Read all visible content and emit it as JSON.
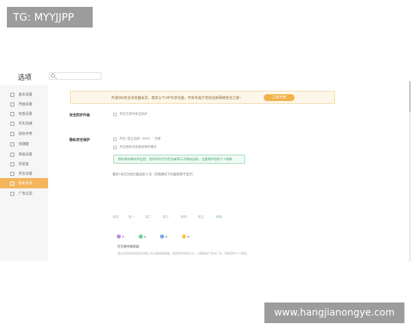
{
  "watermarks": {
    "top": "TG: MYYJJPP",
    "bottom": "www.hangjianongye.com"
  },
  "window": {
    "title": "选项",
    "search": {
      "placeholder": ""
    }
  },
  "sidebar": {
    "items": [
      {
        "label": "基本设置",
        "icon": "gear-icon"
      },
      {
        "label": "界面设置",
        "icon": "layout-icon"
      },
      {
        "label": "标签设置",
        "icon": "tab-icon"
      },
      {
        "label": "优化加速",
        "icon": "rocket-icon"
      },
      {
        "label": "鼠标手势",
        "icon": "mouse-icon"
      },
      {
        "label": "快捷键",
        "icon": "keyboard-icon"
      },
      {
        "label": "高级设置",
        "icon": "advanced-icon"
      },
      {
        "label": "实验室",
        "icon": "lab-icon"
      },
      {
        "label": "安全设置",
        "icon": "shield-icon"
      },
      {
        "label": "隐私专享",
        "icon": "privacy-icon",
        "active": true
      },
      {
        "label": "广告过滤",
        "icon": "block-icon"
      }
    ],
    "active_color": "#f4b55c"
  },
  "vip": {
    "text": "开通360安全浏览器会员，尊享以下VIP专享功能，开启专属于您的全新网络安全之旅~",
    "button": "立即开通"
  },
  "security": {
    "label": "安全防护升级",
    "option": "开启方案中安全防护"
  },
  "privacy": {
    "label": "隐私安全保护",
    "option1": "开启 \"禁止追踪（DNT）\" 功能",
    "option2": "开启隐私浏览痕迹保护模式",
    "tip": "隐私保护模式开启后，您的浏览行为无法被第三方网站追踪，全面保护您的个人隐私",
    "days_text": "最近7天已为您拦截追踪 0 次（无痕模式下拦截结果不显示）",
    "week": [
      "周日",
      "周一",
      "周二",
      "周三",
      "周四",
      "周五",
      "今日"
    ],
    "stats": [
      {
        "icon": "tracker-icon",
        "value": "0",
        "color": "#b98ce0"
      },
      {
        "icon": "cookie-icon",
        "value": "0",
        "color": "#6fcf97"
      },
      {
        "icon": "fingerprint-icon",
        "value": "0",
        "color": "#7fa8e8"
      },
      {
        "icon": "crypto-icon",
        "value": "0",
        "color": "#f2c94c"
      }
    ],
    "block_label": "社交媒体跟踪器",
    "block_desc": "通过在您的浏览网站中植入社交媒体跟踪器，追踪您的浏览行为，以便推送个性化广告，获取您的个人隐私。"
  }
}
